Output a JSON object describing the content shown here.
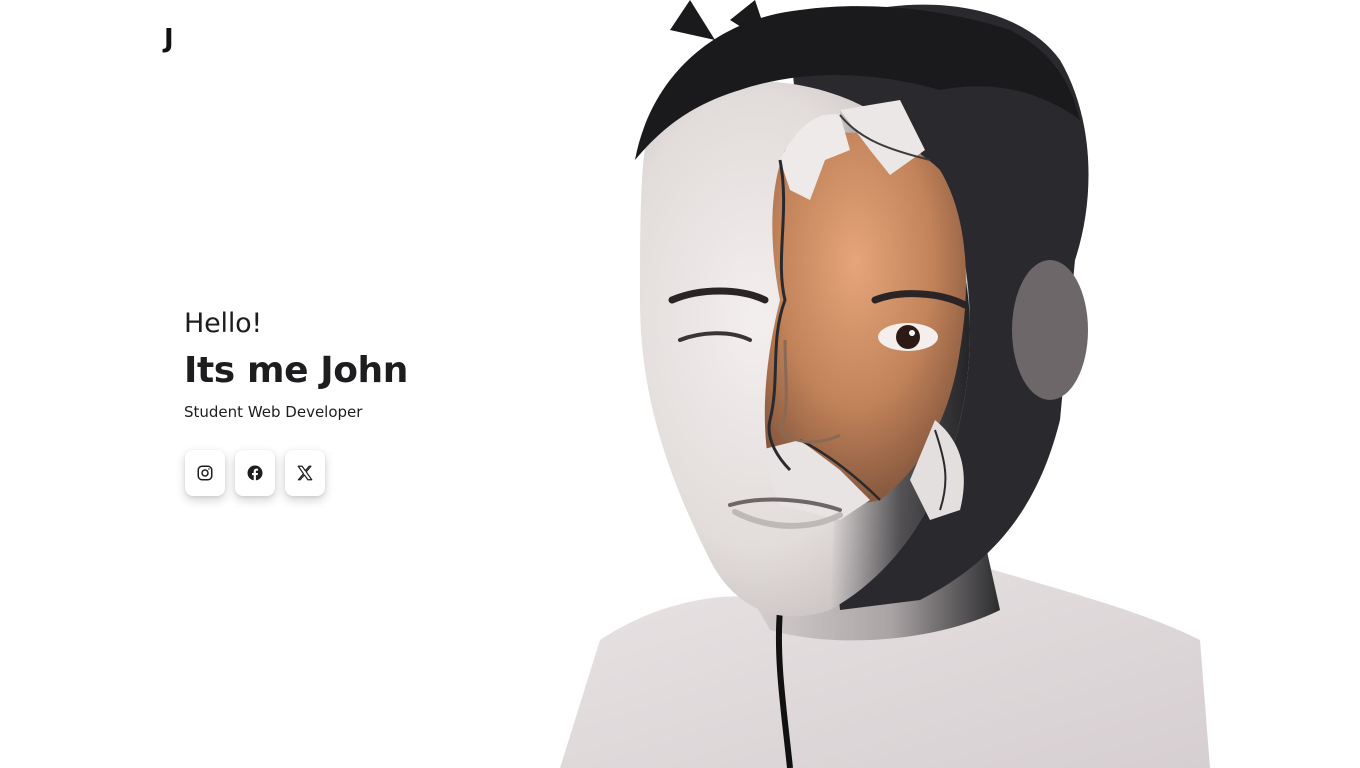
{
  "header": {
    "logo_text": "J"
  },
  "hero": {
    "greeting": "Hello!",
    "headline": "Its me John",
    "role": "Student Web Developer"
  },
  "socials": [
    {
      "name": "Instagram",
      "icon": "instagram-icon"
    },
    {
      "name": "Facebook",
      "icon": "facebook-icon"
    },
    {
      "name": "X",
      "icon": "x-icon"
    }
  ],
  "portrait": {
    "icon": "portrait-image"
  },
  "colors": {
    "background": "#ffffff",
    "text": "#1d1d1f",
    "icon": "#1d1d1f",
    "skin_pale": "#ece7e6",
    "skin_warm": "#c98a5e",
    "hair": "#1a1a1c"
  }
}
